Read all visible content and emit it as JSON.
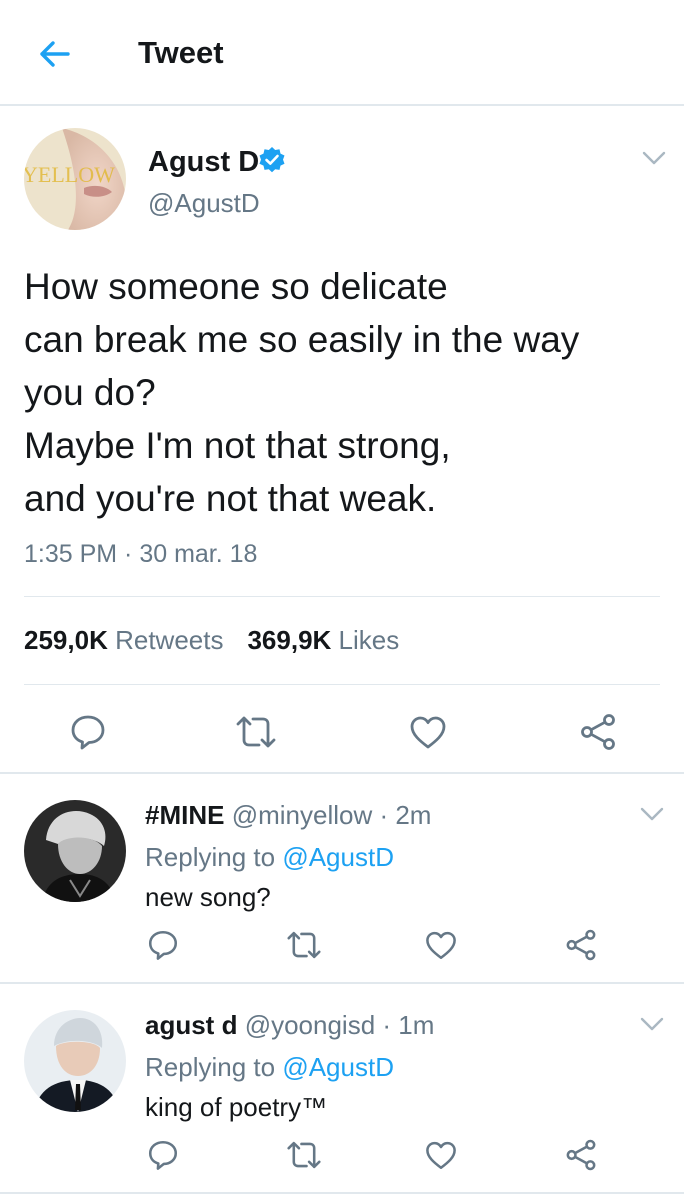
{
  "header": {
    "back_icon": "arrow-left-icon",
    "title": "Tweet",
    "accent_color": "#1da1f2"
  },
  "main_tweet": {
    "author_name": "Agust D",
    "verified_icon": "verified-badge-icon",
    "author_handle": "@AgustD",
    "avatar_text": "YELLOW",
    "text_lines": [
      "How someone so delicate",
      "can break me so easily in the way",
      "you do?",
      "Maybe I'm not that strong,",
      "and you're not that weak."
    ],
    "timestamp": "1:35 PM · 30 mar. 18",
    "retweets_count": "259,0K",
    "retweets_label": "Retweets",
    "likes_count": "369,9K",
    "likes_label": "Likes",
    "actions": [
      "reply-icon",
      "retweet-icon",
      "like-icon",
      "share-icon"
    ]
  },
  "replies": [
    {
      "name": "#MINE",
      "handle": "@minyellow · 2m",
      "replying_prefix": "Replying to",
      "replying_to": "@AgustD",
      "text": "new song?"
    },
    {
      "name": "agust d",
      "handle": "@yoongisd · 1m",
      "replying_prefix": "Replying to",
      "replying_to": "@AgustD",
      "text": "king of poetry™"
    }
  ]
}
